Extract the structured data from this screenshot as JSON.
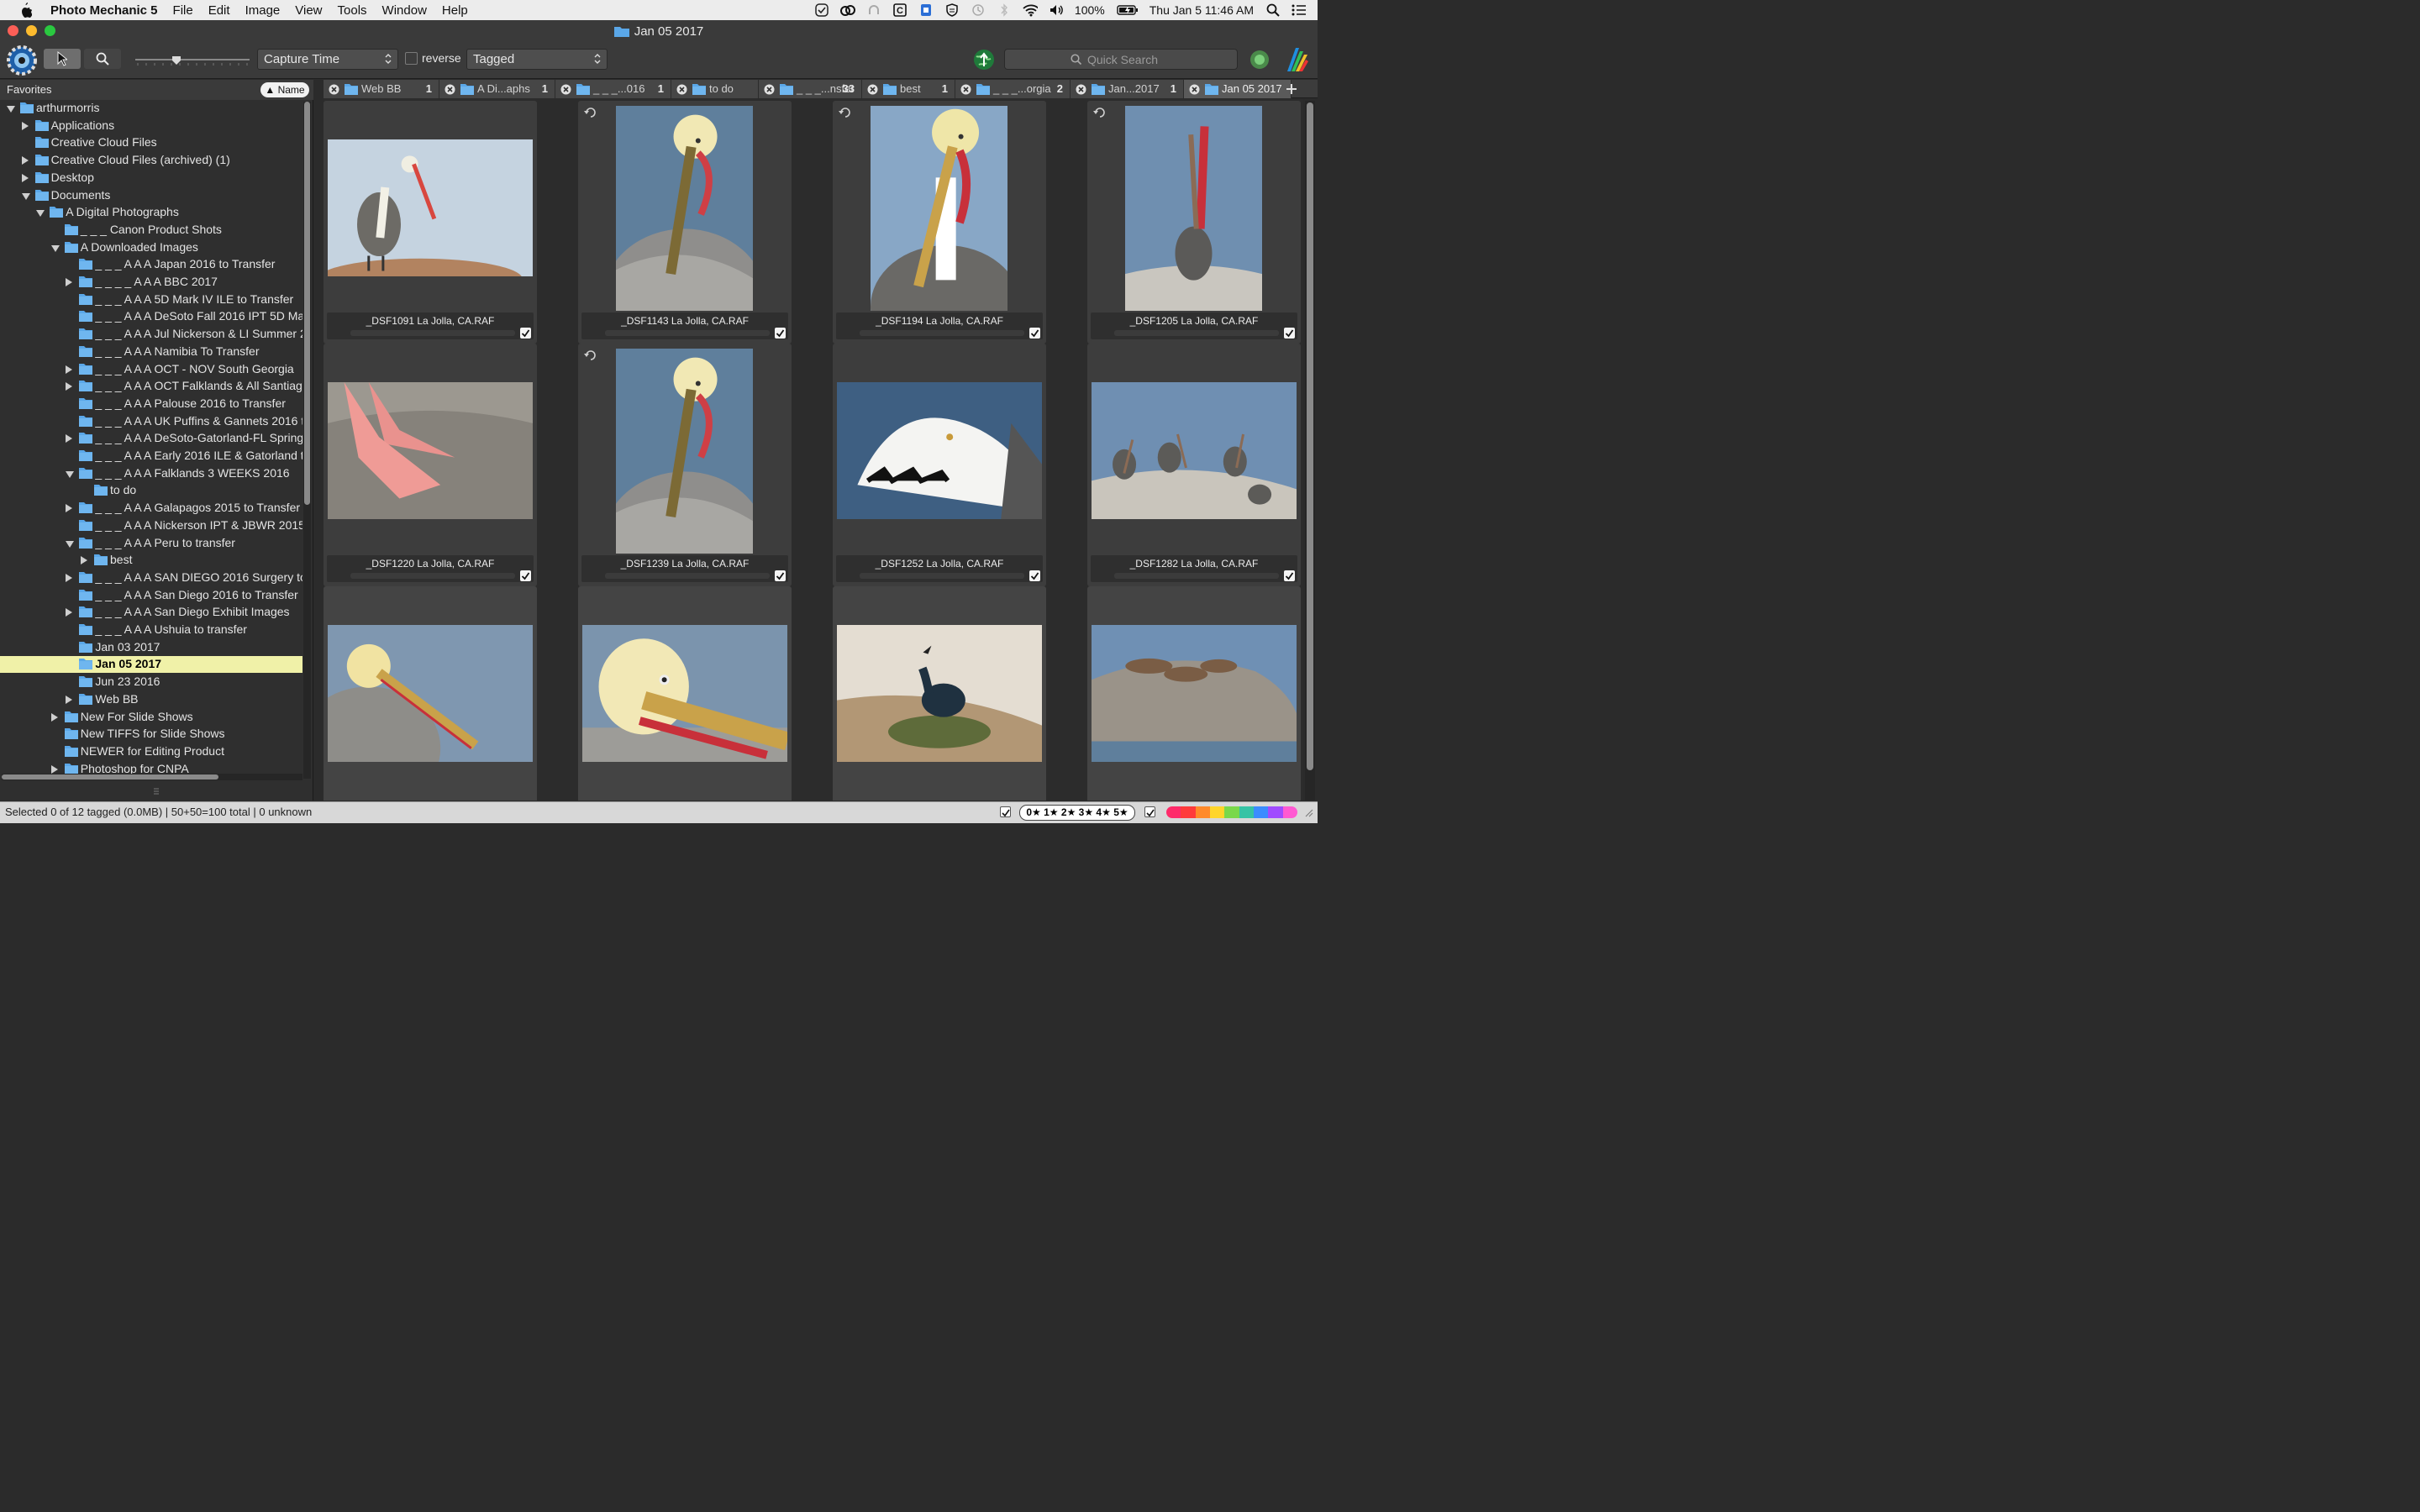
{
  "menubar": {
    "app_name": "Photo Mechanic 5",
    "items": [
      "File",
      "Edit",
      "Image",
      "View",
      "Tools",
      "Window",
      "Help"
    ],
    "battery": "100%",
    "clock": "Thu Jan 5  11:46 AM"
  },
  "window": {
    "title": "Jan 05 2017"
  },
  "toolbar": {
    "sort_field": "Capture Time",
    "reverse_label": "reverse",
    "filter_field": "Tagged",
    "search_placeholder": "Quick Search"
  },
  "sidebar": {
    "header": "Favorites",
    "sort_button": "▲ Name",
    "tree": [
      {
        "label": "arthurmorris",
        "level": 0,
        "state": "expanded"
      },
      {
        "label": "Applications",
        "level": 1,
        "state": "collapsed"
      },
      {
        "label": "Creative Cloud Files",
        "level": 1,
        "state": "none"
      },
      {
        "label": "Creative Cloud Files (archived) (1)",
        "level": 1,
        "state": "collapsed"
      },
      {
        "label": "Desktop",
        "level": 1,
        "state": "collapsed"
      },
      {
        "label": "Documents",
        "level": 1,
        "state": "expanded"
      },
      {
        "label": "A Digital Photographs",
        "level": 2,
        "state": "expanded"
      },
      {
        "label": "_ _ _ Canon Product Shots",
        "level": 3,
        "state": "none"
      },
      {
        "label": "A Downloaded Images",
        "level": 3,
        "state": "expanded"
      },
      {
        "label": "_ _ _ A A A Japan 2016 to Transfer",
        "level": 4,
        "state": "none"
      },
      {
        "label": "_ _ _ _ A A A BBC 2017",
        "level": 4,
        "state": "collapsed"
      },
      {
        "label": "_ _ _ A A A  5D Mark IV ILE to Transfer",
        "level": 4,
        "state": "none"
      },
      {
        "label": "_ _ _ A A A  DeSoto Fall 2016 IPT 5D Mark",
        "level": 4,
        "state": "none"
      },
      {
        "label": "_ _ _ A A A  Jul Nickerson & LI Summer 2",
        "level": 4,
        "state": "none"
      },
      {
        "label": "_ _ _ A A A  Namibia To Transfer",
        "level": 4,
        "state": "none"
      },
      {
        "label": "_ _ _ A A A  OCT - NOV South Georgia",
        "level": 4,
        "state": "collapsed"
      },
      {
        "label": "_ _ _ A A A  OCT Falklands & All Santiago",
        "level": 4,
        "state": "collapsed"
      },
      {
        "label": "_ _ _ A A A  Palouse 2016 to Transfer",
        "level": 4,
        "state": "none"
      },
      {
        "label": "_ _ _ A A A  UK Puffins & Gannets 2016 t",
        "level": 4,
        "state": "none"
      },
      {
        "label": "_ _ _ A A A DeSoto-Gatorland-FL Spring",
        "level": 4,
        "state": "collapsed"
      },
      {
        "label": "_ _ _ A A A Early 2016 ILE & Gatorland to",
        "level": 4,
        "state": "none"
      },
      {
        "label": "_ _ _ A A A Falklands 3 WEEKS 2016",
        "level": 4,
        "state": "expanded"
      },
      {
        "label": "to do",
        "level": 5,
        "state": "none"
      },
      {
        "label": "_ _ _ A A A Galapagos 2015 to Transfer",
        "level": 4,
        "state": "collapsed"
      },
      {
        "label": "_ _ _ A A A Nickerson IPT & JBWR 2015",
        "level": 4,
        "state": "none"
      },
      {
        "label": "_ _ _ A A A Peru to transfer",
        "level": 4,
        "state": "expanded"
      },
      {
        "label": "best",
        "level": 5,
        "state": "collapsed"
      },
      {
        "label": "_ _ _ A A A SAN DIEGO 2016 Surgery to T",
        "level": 4,
        "state": "collapsed"
      },
      {
        "label": "_ _ _ A A A San Diego 2016 to Transfer",
        "level": 4,
        "state": "none"
      },
      {
        "label": "_ _ _ A A A San Diego Exhibit Images",
        "level": 4,
        "state": "collapsed"
      },
      {
        "label": "_ _ _ A A A Ushuia to transfer",
        "level": 4,
        "state": "none"
      },
      {
        "label": "Jan 03 2017",
        "level": 4,
        "state": "none"
      },
      {
        "label": "Jan 05 2017",
        "level": 4,
        "state": "none",
        "selected": true
      },
      {
        "label": "Jun 23 2016",
        "level": 4,
        "state": "none"
      },
      {
        "label": "Web BB",
        "level": 4,
        "state": "collapsed"
      },
      {
        "label": "New For Slide Shows",
        "level": 3,
        "state": "collapsed"
      },
      {
        "label": "New TIFFS for Slide Shows",
        "level": 3,
        "state": "none"
      },
      {
        "label": "NEWER for Editing Product",
        "level": 3,
        "state": "none"
      },
      {
        "label": "Photoshop for CNPA",
        "level": 3,
        "state": "collapsed"
      }
    ]
  },
  "tabs": [
    {
      "name": "Web BB",
      "count": "1"
    },
    {
      "name": "A Di...aphs",
      "count": "1"
    },
    {
      "name": "_ _ _...016",
      "count": "1"
    },
    {
      "name": "to do",
      "count": ""
    },
    {
      "name": "_ _ _...nsfer",
      "count": "33"
    },
    {
      "name": "best",
      "count": "1"
    },
    {
      "name": "_ _ _...orgia",
      "count": "2"
    },
    {
      "name": "Jan...2017",
      "count": "1"
    },
    {
      "name": "Jan 05 2017",
      "count": "",
      "active": true
    }
  ],
  "thumbnails": [
    {
      "filename": "_DSF1091 La Jolla, CA.RAF",
      "orientation": "landscape",
      "subject": "pelican-standing-on-rock",
      "tagged": true,
      "rotated": false
    },
    {
      "filename": "_DSF1143 La Jolla, CA.RAF",
      "orientation": "portrait",
      "subject": "pelican-preening-portrait",
      "tagged": true,
      "rotated": true
    },
    {
      "filename": "_DSF1194 La Jolla, CA.RAF",
      "orientation": "portrait",
      "subject": "pelican-head-portrait",
      "tagged": true,
      "rotated": true
    },
    {
      "filename": "_DSF1205 La Jolla, CA.RAF",
      "orientation": "portrait",
      "subject": "pelican-head-toss",
      "tagged": true,
      "rotated": true
    },
    {
      "filename": "_DSF1220 La Jolla, CA.RAF",
      "orientation": "landscape",
      "subject": "pelican-feet-on-rock",
      "tagged": true,
      "rotated": false
    },
    {
      "filename": "_DSF1239 La Jolla, CA.RAF",
      "orientation": "portrait",
      "subject": "pelican-preening-portrait",
      "tagged": true,
      "rotated": true
    },
    {
      "filename": "_DSF1252 La Jolla, CA.RAF",
      "orientation": "landscape",
      "subject": "white-pelican-wing",
      "tagged": true,
      "rotated": false
    },
    {
      "filename": "_DSF1282 La Jolla, CA.RAF",
      "orientation": "landscape",
      "subject": "pelican-group-on-rocks",
      "tagged": true,
      "rotated": false
    },
    {
      "filename": "",
      "orientation": "landscape",
      "subject": "pelican-head-closeup",
      "tagged": false,
      "rotated": false
    },
    {
      "filename": "",
      "orientation": "landscape",
      "subject": "pelican-face-closeup",
      "tagged": false,
      "rotated": false
    },
    {
      "filename": "",
      "orientation": "landscape",
      "subject": "cormorant-on-nest",
      "tagged": false,
      "rotated": false
    },
    {
      "filename": "",
      "orientation": "landscape",
      "subject": "sea-lions-on-rocks",
      "tagged": false,
      "rotated": false
    }
  ],
  "statusbar": {
    "summary": "Selected 0 of 12 tagged (0.0MB) | 50+50=100 total | 0 unknown",
    "star_filter": "0★ 1★ 2★ 3★ 4★ 5★"
  },
  "colors": {
    "selected_row": "#f0f1a8",
    "folder": "#5aa7e8",
    "label_strip": [
      "#ff2a6a",
      "#ff3b3b",
      "#ff8a2a",
      "#ffd52a",
      "#7ad84a",
      "#35c3a5",
      "#3b8cff",
      "#a04bff",
      "#ff5ad2"
    ]
  }
}
